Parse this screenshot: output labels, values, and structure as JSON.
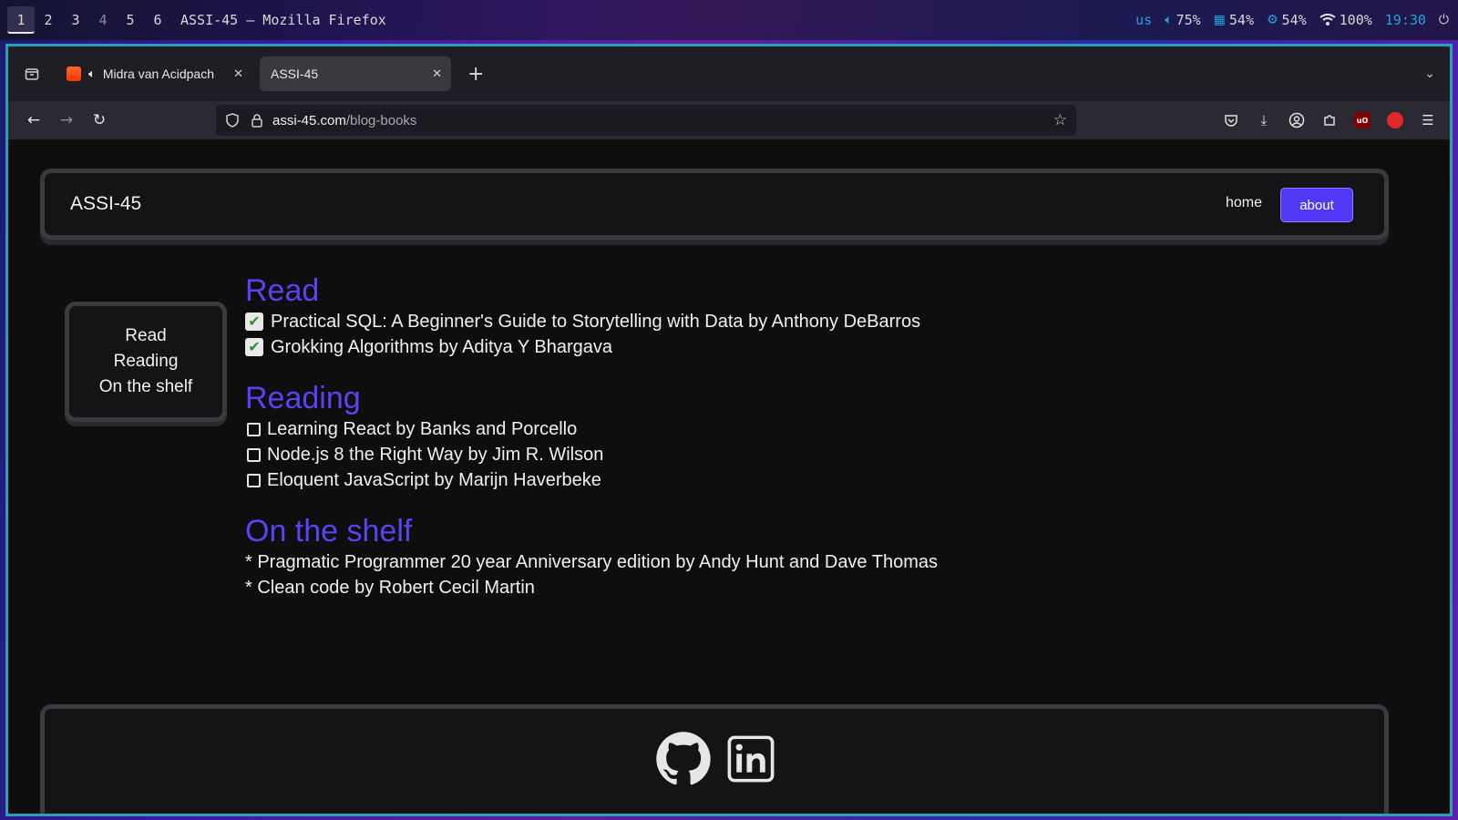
{
  "system_bar": {
    "workspaces": [
      "1",
      "2",
      "3",
      "4",
      "5",
      "6"
    ],
    "window_title": "ASSI-45 — Mozilla Firefox",
    "keyboard_layout": "us",
    "volume": "75%",
    "memory": "54%",
    "cpu": "54%",
    "wifi": "100%",
    "clock": "19:30"
  },
  "browser": {
    "tabs": [
      {
        "title": "Midra van Acidpach"
      },
      {
        "title": "ASSI-45"
      }
    ],
    "url_host": "assi-45.com",
    "url_path": "/blog-books"
  },
  "site": {
    "title": "ASSI-45",
    "nav": {
      "home": "home",
      "about": "about"
    },
    "sidebar_links": [
      "Read",
      "Reading",
      "On the shelf"
    ],
    "sections": {
      "read": {
        "title": "Read",
        "items": [
          "Practical SQL: A Beginner's Guide to Storytelling with Data by Anthony DeBarros",
          "Grokking Algorithms by Aditya Y Bhargava"
        ]
      },
      "reading": {
        "title": "Reading",
        "items": [
          "Learning React by Banks and Porcello",
          "Node.js 8 the Right Way by Jim R. Wilson",
          "Eloquent JavaScript by Marijn Haverbeke"
        ]
      },
      "shelf": {
        "title": "On the shelf",
        "items": [
          "* Pragmatic Programmer 20 year Anniversary edition by Andy Hunt and Dave Thomas",
          "* Clean code by Robert Cecil Martin"
        ]
      }
    },
    "footer_icons": [
      "github-icon",
      "linkedin-icon"
    ]
  },
  "colors": {
    "accent": "#5a43f3",
    "button": "#4f39f6",
    "status_accent": "#1fa4d6",
    "window_border": "#2a9fb7"
  }
}
